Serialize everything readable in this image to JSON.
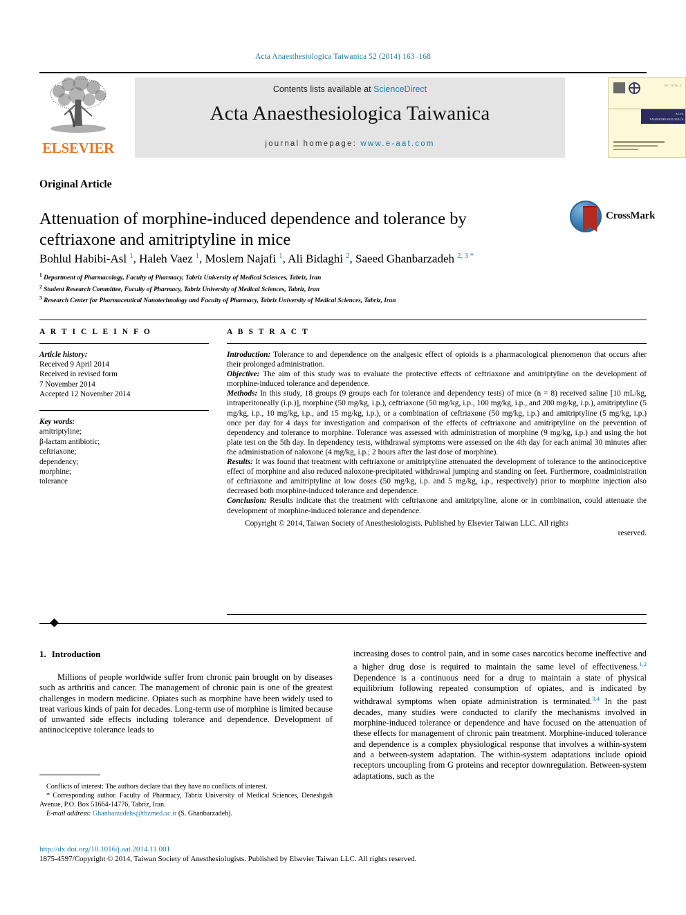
{
  "running_head": "Acta Anaesthesiologica Taiwanica 52 (2014) 163–168",
  "masthead": {
    "contents_prefix": "Contents lists available at ",
    "sciencedirect": "ScienceDirect",
    "journal_name": "Acta Anaesthesiologica Taiwanica",
    "homepage_prefix": "journal homepage: ",
    "homepage_url": "www.e-aat.com",
    "publisher_logo_text": "ELSEVIER",
    "publisher_logo_icon": "elsevier-tree-icon",
    "cover_band_line1": "ACTA ANAESTHESIOLOGICA",
    "cover_band_line2": "TAIWANICA",
    "cover_corner_text": "Vol. 52 No. 4"
  },
  "article": {
    "type": "Original Article",
    "title": "Attenuation of morphine-induced dependence and tolerance by ceftriaxone and amitriptyline in mice",
    "crossmark_label": "CrossMark",
    "authors_html": "Bohlul Habibi-Asl <sup>1</sup>, Haleh Vaez <sup>1</sup>, Moslem Najafi <sup>1</sup>, Ali Bidaghi <sup>2</sup>, Saeed Ghanbarzadeh <sup>2, 3 *</sup>",
    "affiliations": [
      {
        "marker": "1",
        "text": "Department of Pharmacology, Faculty of Pharmacy, Tabriz University of Medical Sciences, Tabriz, Iran"
      },
      {
        "marker": "2",
        "text": "Student Research Committee, Faculty of Pharmacy, Tabriz University of Medical Sciences, Tabriz, Iran"
      },
      {
        "marker": "3",
        "text": "Research Center for Pharmaceutical Nanotechnology and Faculty of Pharmacy, Tabriz University of Medical Sciences, Tabriz, Iran"
      }
    ]
  },
  "article_info": {
    "heading": "A R T I C L E   I N F O",
    "history_label": "Article history:",
    "history": [
      "Received 9 April 2014",
      "Received in revised form",
      "7 November 2014",
      "Accepted 12 November 2014"
    ],
    "keywords_label": "Key words:",
    "keywords": [
      "amitriptyline;",
      "β-lactam antibiotic;",
      "ceftriaxone;",
      "dependency;",
      "morphine;",
      "tolerance"
    ]
  },
  "abstract": {
    "heading": "A B S T R A C T",
    "sections": [
      {
        "label": "Introduction:",
        "text": " Tolerance to and dependence on the analgesic effect of opioids is a pharmacological phenomenon that occurs after their prolonged administration."
      },
      {
        "label": "Objective:",
        "text": " The aim of this study was to evaluate the protective effects of ceftriaxone and amitriptyline on the development of morphine-induced tolerance and dependence."
      },
      {
        "label": "Methods:",
        "text": " In this study, 18 groups (9 groups each for tolerance and dependency tests) of mice (n = 8) received saline [10 mL/kg, intraperitoneally (i.p.)], morphine (50 mg/kg, i.p.), ceftriaxone (50 mg/kg, i.p., 100 mg/kg, i.p., and 200 mg/kg, i.p.), amitriptyline (5 mg/kg, i.p., 10 mg/kg, i.p., and 15 mg/kg, i.p.), or a combination of ceftriaxone (50 mg/kg, i.p.) and amitriptyline (5 mg/kg, i.p.) once per day for 4 days for investigation and comparison of the effects of ceftriaxone and amitriptyline on the prevention of dependency and tolerance to morphine. Tolerance was assessed with administration of morphine (9 mg/kg, i.p.) and using the hot plate test on the 5th day. In dependency tests, withdrawal symptoms were assessed on the 4th day for each animal 30 minutes after the administration of naloxone (4 mg/kg, i.p.; 2 hours after the last dose of morphine)."
      },
      {
        "label": "Results:",
        "text": " It was found that treatment with ceftriaxone or amitriptyline attenuated the development of tolerance to the antinociceptive effect of morphine and also reduced naloxone-precipitated withdrawal jumping and standing on feet. Furthermore, coadministration of ceftriaxone and amitriptyline at low doses (50 mg/kg, i.p. and 5 mg/kg, i.p., respectively) prior to morphine injection also decreased both morphine-induced tolerance and dependence."
      },
      {
        "label": "Conclusion:",
        "text": " Results indicate that the treatment with ceftriaxone and amitriptyline, alone or in combination, could attenuate the development of morphine-induced tolerance and dependence."
      }
    ],
    "copyright_main": "Copyright © 2014, Taiwan Society of Anesthesiologists. Published by Elsevier Taiwan LLC. All rights",
    "copyright_tail": "reserved."
  },
  "body": {
    "section_number": "1.",
    "section_title": "Introduction",
    "left_paragraph": "Millions of people worldwide suffer from chronic pain brought on by diseases such as arthritis and cancer. The management of chronic pain is one of the greatest challenges in modern medicine. Opiates such as morphine have been widely used to treat various kinds of pain for decades. Long-term use of morphine is limited because of unwanted side effects including tolerance and dependence. Development of antinociceptive tolerance leads to",
    "right_paragraph_html": "increasing doses to control pain, and in some cases narcotics become ineffective and a higher drug dose is required to maintain the same level of effectiveness.<sup>1,2</sup> Dependence is a continuous need for a drug to maintain a state of physical equilibrium following repeated consumption of opiates, and is indicated by withdrawal symptoms when opiate administration is terminated.<sup>3,4</sup> In the past decades, many studies were conducted to clarify the mechanisms involved in morphine-induced tolerance or dependence and have focused on the attenuation of these effects for management of chronic pain treatment. Morphine-induced tolerance and dependence is a complex physiological response that involves a within-system and a between-system adaptation. The within-system adaptations include opioid receptors uncoupling from G proteins and receptor downregulation. Between-system adaptations, such as the"
  },
  "footnotes": {
    "conflicts": "Conflicts of interest: The authors declare that they have no conflicts of interest.",
    "corresponding": "* Corresponding author. Faculty of Pharmacy, Tabriz University of Medical Sciences, Deneshgah Avenue, P.O. Box 51664-14776, Tabriz, Iran.",
    "email_label": "E-mail address:",
    "email": "Ghanbarzadehs@tbzmed.ac.ir",
    "email_suffix": " (S. Ghanbarzadeh).",
    "doi": "http://dx.doi.org/10.1016/j.aat.2014.11.001",
    "issn_line": "1875-4597/Copyright © 2014, Taiwan Society of Anesthesiologists. Published by Elsevier Taiwan LLC. All rights reserved."
  },
  "colors": {
    "link_blue": "#1a7aa8",
    "elsevier_orange": "#E87722",
    "crossmark_red": "#b42b20",
    "crossmark_blue": "#3f7fb5"
  }
}
